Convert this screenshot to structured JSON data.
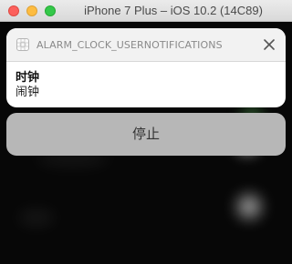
{
  "window": {
    "title": "iPhone 7 Plus – iOS 10.2 (14C89)"
  },
  "notification": {
    "app_icon": "app-placeholder-icon",
    "app_name": "ALARM_CLOCK_USERNOTIFICATIONS",
    "close_icon": "close-icon",
    "title": "时钟",
    "body": "闹钟"
  },
  "actions": {
    "stop_label": "停止"
  },
  "colors": {
    "close_light": "#fc605c",
    "minimize_light": "#fdbc40",
    "maximize_light": "#34c84a",
    "button_background": "#b7b7b7"
  }
}
